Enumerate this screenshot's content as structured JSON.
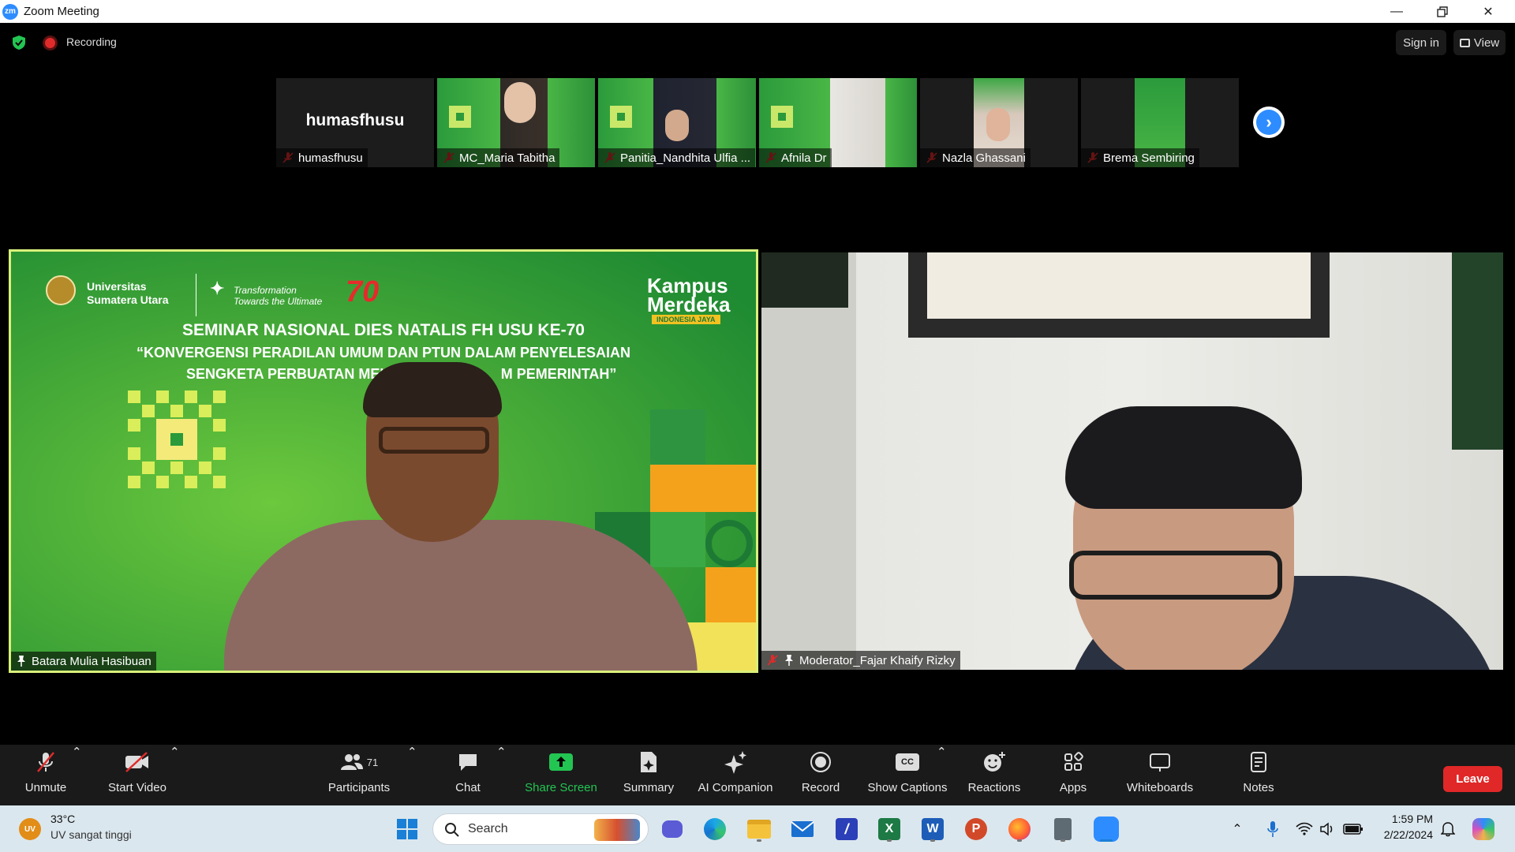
{
  "window": {
    "title": "Zoom Meeting",
    "app_icon_text": "zm"
  },
  "status_bar": {
    "recording_label": "Recording",
    "sign_in_label": "Sign in",
    "view_label": "View"
  },
  "thumbnails": [
    {
      "name": "humasfhusu",
      "big_name": "humasfhusu",
      "muted": true
    },
    {
      "name": "MC_Maria Tabitha",
      "muted": true
    },
    {
      "name": "Panitia_Nandhita Ulfia ...",
      "muted": true
    },
    {
      "name": "Afnila Dr",
      "muted": true
    },
    {
      "name": "Nazla Ghassani",
      "muted": true
    },
    {
      "name": "Brema Sembiring",
      "muted": true
    }
  ],
  "main_videos": {
    "left": {
      "participant": "Batara Mulia Hasibuan",
      "banner": {
        "university_line1": "Universitas",
        "university_line2": "Sumatera Utara",
        "tagline1": "Transformation",
        "tagline2": "Towards the Ultimate",
        "kampus1": "Kampus",
        "kampus2": "Merdeka",
        "kampus3": "INDONESIA JAYA",
        "headline": "SEMINAR NASIONAL DIES NATALIS FH USU KE-70",
        "sub1": "“KONVERGENSI PERADILAN UMUM DAN PTUN DALAM PENYELESAIAN",
        "sub2": "SENGKETA PERBUATAN MELA",
        "sub2b": "M PEMERINTAH”",
        "seventy": "70"
      }
    },
    "right": {
      "participant": "Moderator_Fajar Khaify Rizky"
    }
  },
  "toolbar": {
    "unmute": "Unmute",
    "start_video": "Start Video",
    "participants": "Participants",
    "participants_count": "71",
    "chat": "Chat",
    "share_screen": "Share Screen",
    "summary": "Summary",
    "ai_companion": "AI Companion",
    "record": "Record",
    "show_captions": "Show Captions",
    "cc_text": "CC",
    "reactions": "Reactions",
    "apps": "Apps",
    "whiteboards": "Whiteboards",
    "notes": "Notes",
    "leave": "Leave"
  },
  "taskbar": {
    "weather_badge": "UV",
    "temperature": "33°C",
    "weather_desc": "UV sangat tinggi",
    "search_placeholder": "Search",
    "time": "1:59 PM",
    "date": "2/22/2024"
  },
  "colors": {
    "accent_blue": "#2d8cff",
    "leave_red": "#e02828",
    "share_green": "#23c552",
    "active_speaker_border": "#d9f07a",
    "toolbar_bg": "#1a1a1a",
    "taskbar_bg": "#dbe7ee"
  }
}
